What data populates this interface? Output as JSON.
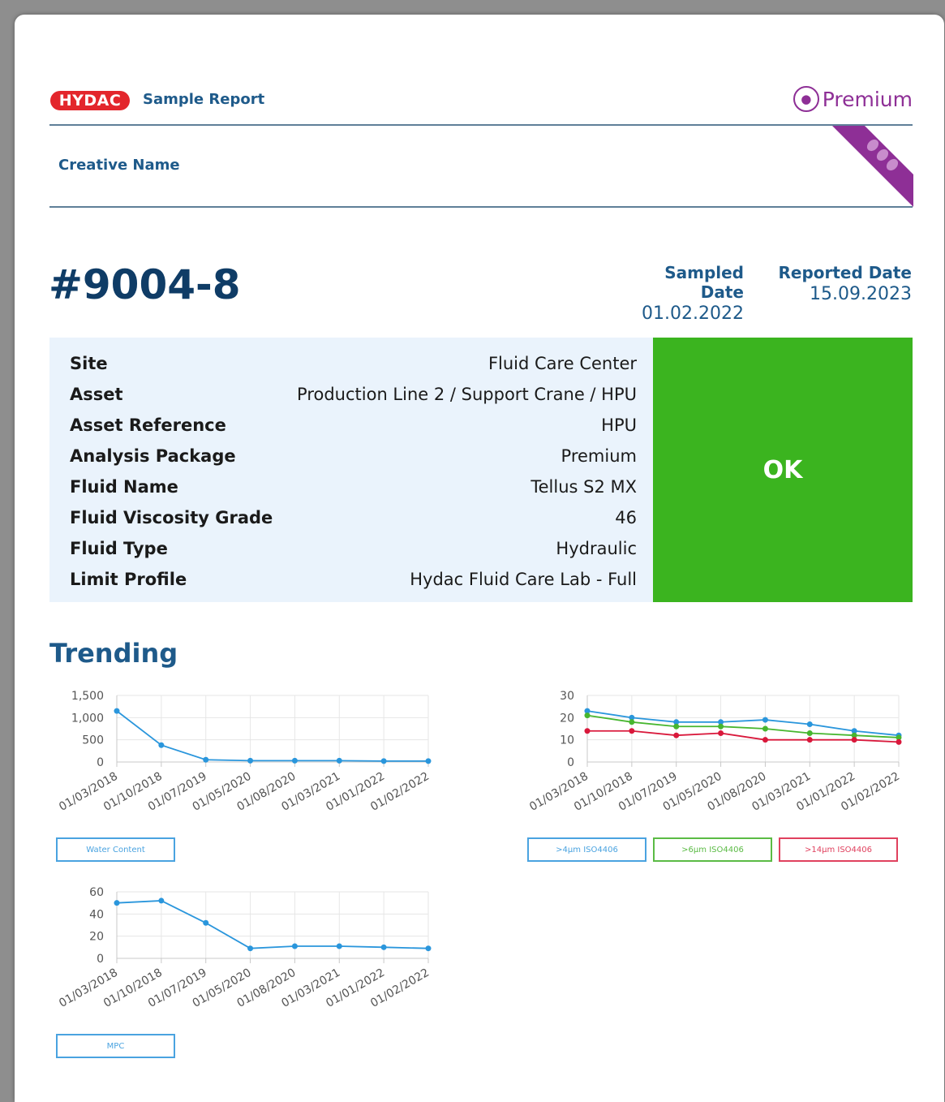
{
  "header": {
    "logo_text": "HYDAC",
    "report_title": "Sample Report",
    "package_badge": "Premium",
    "package_icon": "microscope-icon",
    "creative_name": "Creative Name"
  },
  "sample": {
    "id": "#9004-8",
    "sampled_date_label": "Sampled Date",
    "sampled_date": "01.02.2022",
    "reported_date_label": "Reported Date",
    "reported_date": "15.09.2023"
  },
  "info": [
    {
      "label": "Site",
      "value": "Fluid Care Center"
    },
    {
      "label": "Asset",
      "value": "Production Line 2 / Support Crane / HPU"
    },
    {
      "label": "Asset Reference",
      "value": "HPU"
    },
    {
      "label": "Analysis Package",
      "value": "Premium"
    },
    {
      "label": "Fluid Name",
      "value": "Tellus S2 MX"
    },
    {
      "label": "Fluid Viscosity Grade",
      "value": "46"
    },
    {
      "label": "Fluid Type",
      "value": "Hydraulic"
    },
    {
      "label": "Limit Profile",
      "value": "Hydac Fluid Care Lab - Full"
    }
  ],
  "status": {
    "text": "OK",
    "color": "#3bb41f"
  },
  "colors": {
    "accent": "#1e5a8a",
    "premium": "#8e2f96",
    "logo": "#e3262c"
  },
  "trending_title": "Trending",
  "chart_data": [
    {
      "type": "line",
      "x": [
        "01/03/2018",
        "01/10/2018",
        "01/07/2019",
        "01/05/2020",
        "01/08/2020",
        "01/03/2021",
        "01/01/2022",
        "01/02/2022"
      ],
      "ylim": [
        0,
        1500
      ],
      "yticks": [
        0,
        500,
        1000,
        1500
      ],
      "ytick_labels": [
        "0",
        "500",
        "1,000",
        "1,500"
      ],
      "series": [
        {
          "name": "Water Content",
          "color": "#2a96dc",
          "values": [
            1150,
            380,
            50,
            30,
            30,
            30,
            20,
            20
          ]
        }
      ]
    },
    {
      "type": "line",
      "x": [
        "01/03/2018",
        "01/10/2018",
        "01/07/2019",
        "01/05/2020",
        "01/08/2020",
        "01/03/2021",
        "01/01/2022",
        "01/02/2022"
      ],
      "ylim": [
        0,
        30
      ],
      "yticks": [
        0,
        10,
        20,
        30
      ],
      "ytick_labels": [
        "0",
        "10",
        "20",
        "30"
      ],
      "series": [
        {
          "name": ">4μm ISO4406",
          "color": "#2a96dc",
          "values": [
            23,
            20,
            18,
            18,
            19,
            17,
            14,
            12
          ]
        },
        {
          "name": ">6μm ISO4406",
          "color": "#47b62f",
          "values": [
            21,
            18,
            16,
            16,
            15,
            13,
            12,
            11
          ]
        },
        {
          "name": ">14μm ISO4406",
          "color": "#d9183b",
          "values": [
            14,
            14,
            12,
            13,
            10,
            10,
            10,
            9
          ]
        }
      ]
    },
    {
      "type": "line",
      "x": [
        "01/03/2018",
        "01/10/2018",
        "01/07/2019",
        "01/05/2020",
        "01/08/2020",
        "01/03/2021",
        "01/01/2022",
        "01/02/2022"
      ],
      "ylim": [
        0,
        60
      ],
      "yticks": [
        0,
        20,
        40,
        60
      ],
      "ytick_labels": [
        "0",
        "20",
        "40",
        "60"
      ],
      "series": [
        {
          "name": "MPC",
          "color": "#2a96dc",
          "values": [
            50,
            52,
            32,
            9,
            11,
            11,
            10,
            9
          ]
        }
      ]
    }
  ]
}
